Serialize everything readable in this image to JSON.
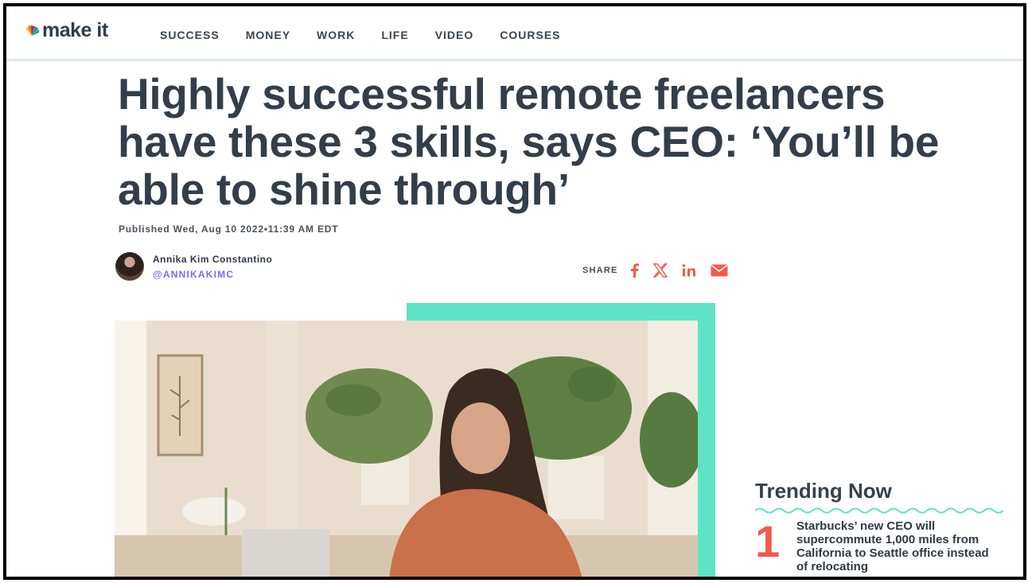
{
  "brand": {
    "logo_text": "make it",
    "peacock_label": "CNBC"
  },
  "nav": {
    "items": [
      "SUCCESS",
      "MONEY",
      "WORK",
      "LIFE",
      "VIDEO",
      "COURSES"
    ]
  },
  "article": {
    "headline": "Highly successful remote freelancers have these 3 skills, says CEO: ‘You’ll be able to shine through’",
    "published": "Published Wed, Aug 10 2022•11:39 AM EDT",
    "author_name": "Annika Kim Constantino",
    "author_handle": "@ANNIKAKIMC"
  },
  "share": {
    "label": "SHARE",
    "icons": [
      "facebook-icon",
      "x-icon",
      "linkedin-icon",
      "email-icon"
    ]
  },
  "trending": {
    "title": "Trending Now",
    "items": [
      {
        "number": "1",
        "text": "Starbucks’ new CEO will supercommute 1,000 miles from California to Seattle office instead of relocating"
      }
    ]
  },
  "colors": {
    "accent": "#f05a4a",
    "teal": "#5fe3c4",
    "handle": "#7a6df0",
    "text": "#333e4a"
  }
}
